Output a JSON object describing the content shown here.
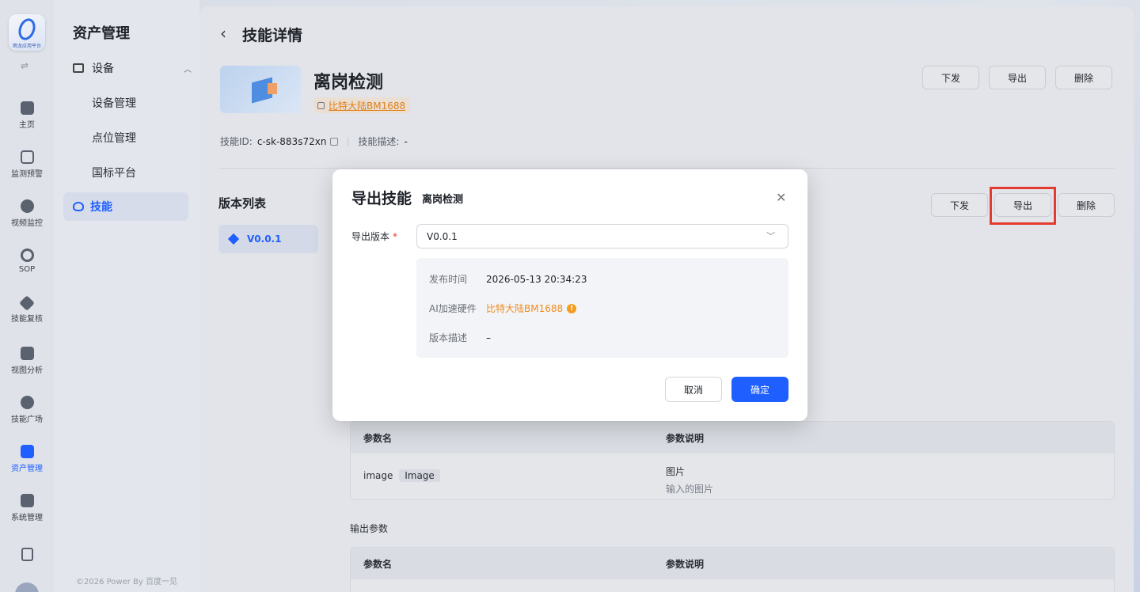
{
  "rail": {
    "logo_caption": "雨龙应用平台",
    "items": [
      {
        "label": "主页",
        "icon": "home-icon"
      },
      {
        "label": "监测预警",
        "icon": "chart-icon"
      },
      {
        "label": "视频监控",
        "icon": "camera-icon"
      },
      {
        "label": "SOP",
        "icon": "sop-icon"
      },
      {
        "label": "技能复核",
        "icon": "review-icon"
      },
      {
        "label": "视图分析",
        "icon": "view-icon"
      },
      {
        "label": "技能广场",
        "icon": "plaza-icon"
      },
      {
        "label": "资产管理",
        "icon": "asset-icon"
      },
      {
        "label": "系统管理",
        "icon": "system-icon"
      }
    ],
    "active": "资产管理"
  },
  "sidebar": {
    "title": "资产管理",
    "group": "设备",
    "subs": [
      "设备管理",
      "点位管理",
      "国标平台"
    ],
    "active": "技能",
    "copyright": "©2026 Power By 百度一见"
  },
  "page": {
    "title": "技能详情",
    "skill_name": "离岗检测",
    "hardware_tag": "比特大陆BM1688",
    "skill_id_label": "技能ID:",
    "skill_id": "c-sk-883s72xn",
    "desc_label": "技能描述:",
    "desc_value": "-",
    "top_actions": [
      "下发",
      "导出",
      "删除"
    ],
    "version_list_title": "版本列表",
    "version_item": "V0.0.1",
    "version_actions": [
      "下发",
      "导出",
      "删除"
    ]
  },
  "input_table": {
    "headers": [
      "参数名",
      "参数说明"
    ],
    "rows": [
      {
        "name": "image",
        "type": "Image",
        "desc": "图片",
        "desc2": "输入的图片"
      }
    ]
  },
  "output_section_label": "输出参数",
  "output_table": {
    "headers": [
      "参数名",
      "参数说明"
    ]
  },
  "modal": {
    "title": "导出技能",
    "subtitle": "离岗检测",
    "field_label": "导出版本",
    "required_mark": "*",
    "selected_version": "V0.0.1",
    "info": [
      {
        "label": "发布时间",
        "value": "2026-05-13 20:34:23"
      },
      {
        "label": "AI加速硬件",
        "value": "比特大陆BM1688"
      },
      {
        "label": "版本描述",
        "value": "–"
      }
    ],
    "warn_glyph": "!",
    "cancel": "取消",
    "confirm": "确定"
  },
  "colors": {
    "accent": "#1f5fff",
    "warning": "#f08c1e",
    "highlight_box": "#e53a2f"
  }
}
